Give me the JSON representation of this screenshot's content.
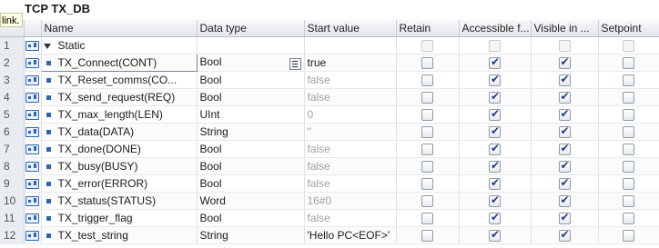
{
  "window": {
    "title": "TCP TX_DB",
    "tooltip": "link."
  },
  "columns": [
    "",
    "",
    "Name",
    "Data type",
    "Start value",
    "Retain",
    "Accessible f...",
    "Visible in ...",
    "Setpoint"
  ],
  "rows": [
    {
      "num": "1",
      "name": "Static",
      "type": "",
      "start": "",
      "retain": false,
      "access": false,
      "visible": false,
      "setpoint": false,
      "group": true
    },
    {
      "num": "2",
      "name": "TX_Connect(CONT)",
      "type": "Bool",
      "start": "true",
      "retain": false,
      "access": true,
      "visible": true,
      "setpoint": false,
      "selected": true
    },
    {
      "num": "3",
      "name": "TX_Reset_comms(CO...",
      "type": "Bool",
      "start": "false",
      "retain": false,
      "access": true,
      "visible": true,
      "setpoint": false
    },
    {
      "num": "4",
      "name": "TX_send_request(REQ)",
      "type": "Bool",
      "start": "false",
      "retain": false,
      "access": true,
      "visible": true,
      "setpoint": false
    },
    {
      "num": "5",
      "name": "TX_max_length(LEN)",
      "type": "UInt",
      "start": "0",
      "retain": false,
      "access": true,
      "visible": true,
      "setpoint": false
    },
    {
      "num": "6",
      "name": "TX_data(DATA)",
      "type": "String",
      "start": "''",
      "retain": false,
      "access": true,
      "visible": true,
      "setpoint": false
    },
    {
      "num": "7",
      "name": "TX_done(DONE)",
      "type": "Bool",
      "start": "false",
      "retain": false,
      "access": true,
      "visible": true,
      "setpoint": false
    },
    {
      "num": "8",
      "name": "TX_busy(BUSY)",
      "type": "Bool",
      "start": "false",
      "retain": false,
      "access": true,
      "visible": true,
      "setpoint": false
    },
    {
      "num": "9",
      "name": "TX_error(ERROR)",
      "type": "Bool",
      "start": "false",
      "retain": false,
      "access": true,
      "visible": true,
      "setpoint": false
    },
    {
      "num": "10",
      "name": "TX_status(STATUS)",
      "type": "Word",
      "start": "16#0",
      "retain": false,
      "access": true,
      "visible": true,
      "setpoint": false
    },
    {
      "num": "11",
      "name": "TX_trigger_flag",
      "type": "Bool",
      "start": "false",
      "retain": false,
      "access": true,
      "visible": true,
      "setpoint": false
    },
    {
      "num": "12",
      "name": "TX_test_string",
      "type": "String",
      "start": "'Hello PC<EOF>'",
      "retain": false,
      "access": true,
      "visible": true,
      "setpoint": false
    }
  ]
}
